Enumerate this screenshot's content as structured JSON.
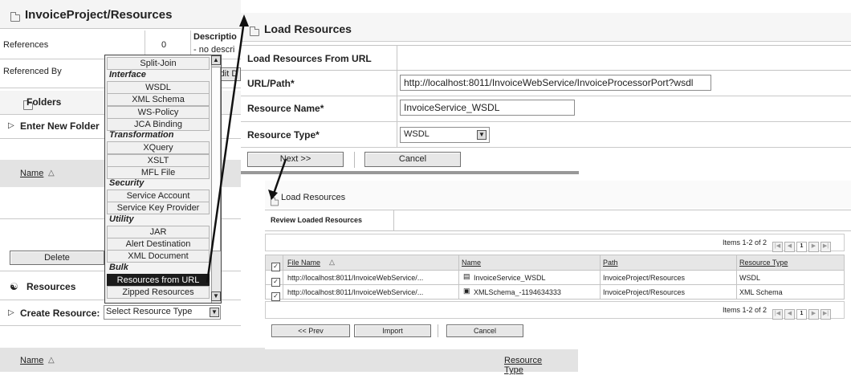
{
  "bg_project": {
    "title": "InvoiceProject/Resources",
    "references_label": "References",
    "references_value": "0",
    "description_label": "Descriptio",
    "description_value": "- no descri",
    "referenced_by_label": "Referenced By",
    "edit_label": "dit D",
    "folders_title": "Folders",
    "enter_new_folder": "Enter New Folder",
    "name_header": "Name",
    "delete_button": "Delete",
    "resources_title": "Resources",
    "create_resource_label": "Create Resource:",
    "select_resource_type": "Select Resource Type",
    "bottom_name_header": "Name",
    "bottom_resource_type_header": "Resource Type"
  },
  "menu": {
    "top_item": "Split-Join",
    "groups": [
      {
        "label": "Interface",
        "items": [
          "WSDL",
          "XML Schema",
          "WS-Policy",
          "JCA Binding"
        ]
      },
      {
        "label": "Transformation",
        "items": [
          "XQuery",
          "XSLT",
          "MFL File"
        ]
      },
      {
        "label": "Security",
        "items": [
          "Service Account",
          "Service Key Provider"
        ]
      },
      {
        "label": "Utility",
        "items": [
          "JAR",
          "Alert Destination",
          "XML Document"
        ]
      },
      {
        "label": "Bulk",
        "items": [
          "Resources from URL",
          "Zipped Resources"
        ]
      }
    ]
  },
  "load_dialog": {
    "title": "Load Resources",
    "section": "Load Resources From URL",
    "url_label": "URL/Path*",
    "url_value": "http://localhost:8011/InvoiceWebService/InvoiceProcessorPort?wsdl",
    "name_label": "Resource Name*",
    "name_value": "InvoiceService_WSDL",
    "type_label": "Resource Type*",
    "type_value": "WSDL",
    "next_button": "Next >>",
    "cancel_button": "Cancel"
  },
  "review_dialog": {
    "title": "Load Resources",
    "section": "Review Loaded Resources",
    "pager_text": "Items 1-2 of 2",
    "page_number": "1",
    "columns": [
      "File Name",
      "Name",
      "Path",
      "Resource Type"
    ],
    "rows": [
      {
        "file": "http://localhost:8011/InvoiceWebService/...",
        "name": "InvoiceService_WSDL",
        "path": "InvoiceProject/Resources",
        "type": "WSDL"
      },
      {
        "file": "http://localhost:8011/InvoiceWebService/...",
        "name": "XMLSchema_-1194634333",
        "path": "InvoiceProject/Resources",
        "type": "XML Schema"
      }
    ],
    "prev_button": "<< Prev",
    "import_button": "Import",
    "cancel_button": "Cancel"
  }
}
